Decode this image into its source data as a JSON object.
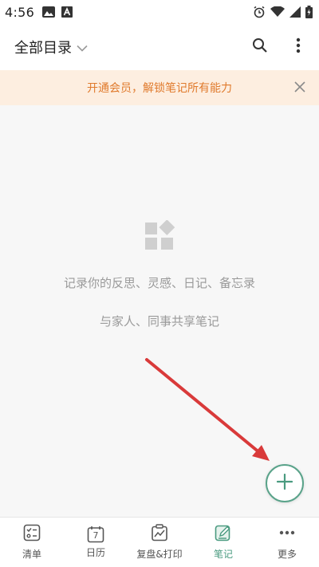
{
  "status_bar": {
    "time": "4:56",
    "left_icons": [
      "image-icon",
      "a-icon"
    ],
    "right_icons": [
      "alarm-icon",
      "wifi-icon",
      "signal-icon",
      "battery-icon"
    ]
  },
  "header": {
    "title": "全部目录",
    "dropdown_icon": "chevron-down-icon",
    "search_icon": "search-icon",
    "more_icon": "more-vertical-icon"
  },
  "promo": {
    "text": "开通会员，解锁笔记所有能力",
    "close_icon": "close-icon"
  },
  "empty_state": {
    "icon": "widgets-icon",
    "line1": "记录你的反思、灵感、日记、备忘录",
    "line2": "与家人、同事共享笔记"
  },
  "fab": {
    "icon": "plus-icon"
  },
  "bottom_nav": {
    "items": [
      {
        "label": "清单",
        "icon": "checklist-icon",
        "active": false
      },
      {
        "label": "日历",
        "icon": "calendar-icon",
        "day": "7",
        "active": false
      },
      {
        "label": "复盘&打印",
        "icon": "review-print-icon",
        "active": false
      },
      {
        "label": "笔记",
        "icon": "note-edit-icon",
        "active": true
      },
      {
        "label": "更多",
        "icon": "more-horizontal-icon",
        "active": false
      }
    ]
  },
  "colors": {
    "accent": "#4a9b80",
    "promo_bg": "#fdeee0",
    "promo_text": "#e07a2c",
    "annotation_arrow": "#d93a3a"
  }
}
